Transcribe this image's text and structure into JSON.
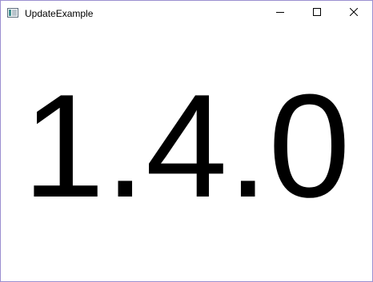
{
  "window": {
    "title": "UpdateExample",
    "border_color": "#9b8fd0",
    "icons": {
      "app": "app-window-icon",
      "minimize": "minimize-icon",
      "maximize": "maximize-icon",
      "close": "close-icon"
    }
  },
  "main": {
    "version_text": "1.4.0"
  }
}
